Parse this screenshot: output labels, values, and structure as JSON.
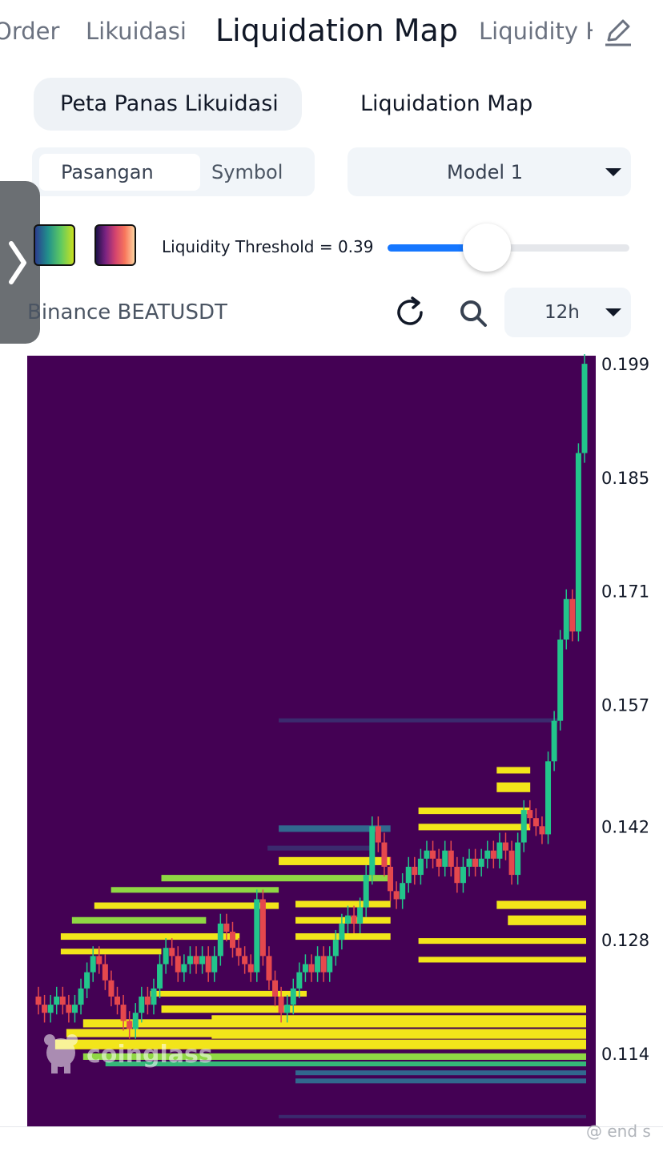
{
  "nav": {
    "order": "Order",
    "likuidasi": "Likuidasi",
    "liquidation_map": "Liquidation Map",
    "liquidity_heatmap": "Liquidity Heatmap"
  },
  "segment": {
    "heatmap": "Peta Panas Likuidasi",
    "map": "Liquidation Map"
  },
  "pair_toggle": {
    "pair": "Pasangan",
    "symbol": "Symbol"
  },
  "model": {
    "selected": "Model 1"
  },
  "threshold": {
    "label": "Liquidity Threshold = 0.39",
    "value": 0.39
  },
  "symbol_title": "Binance BEATUSDT",
  "timeframe": {
    "selected": "12h"
  },
  "icons": {
    "edit": "pencil-icon",
    "refresh": "refresh-icon",
    "search": "search-icon",
    "handle": "chevron-right-icon",
    "logo": "coinglass-logo-icon"
  },
  "watermark": "coinglass",
  "footer_watermark": "@ end s",
  "colors": {
    "heatmap_bg": "#440154",
    "bull": "#22c58b",
    "bear": "#e5484d",
    "accent": "#1677ff"
  },
  "chart_data": {
    "type": "heatmap",
    "y_ticks": [
      "0.199",
      "0.185",
      "0.171",
      "0.157",
      "0.142",
      "0.128",
      "0.114"
    ],
    "ylim": [
      0.105,
      0.2
    ],
    "candles": [
      [
        0.121,
        0.12
      ],
      [
        0.12,
        0.119
      ],
      [
        0.119,
        0.12
      ],
      [
        0.12,
        0.121
      ],
      [
        0.121,
        0.12
      ],
      [
        0.12,
        0.119
      ],
      [
        0.119,
        0.12
      ],
      [
        0.12,
        0.122
      ],
      [
        0.122,
        0.124
      ],
      [
        0.124,
        0.126
      ],
      [
        0.126,
        0.125
      ],
      [
        0.125,
        0.123
      ],
      [
        0.123,
        0.121
      ],
      [
        0.121,
        0.12
      ],
      [
        0.12,
        0.118
      ],
      [
        0.118,
        0.117
      ],
      [
        0.117,
        0.119
      ],
      [
        0.119,
        0.121
      ],
      [
        0.121,
        0.12
      ],
      [
        0.12,
        0.122
      ],
      [
        0.122,
        0.125
      ],
      [
        0.125,
        0.127
      ],
      [
        0.127,
        0.126
      ],
      [
        0.126,
        0.124
      ],
      [
        0.124,
        0.125
      ],
      [
        0.125,
        0.126
      ],
      [
        0.126,
        0.125
      ],
      [
        0.125,
        0.126
      ],
      [
        0.126,
        0.124
      ],
      [
        0.124,
        0.126
      ],
      [
        0.126,
        0.13
      ],
      [
        0.13,
        0.129
      ],
      [
        0.129,
        0.127
      ],
      [
        0.127,
        0.126
      ],
      [
        0.126,
        0.125
      ],
      [
        0.125,
        0.124
      ],
      [
        0.124,
        0.133
      ],
      [
        0.133,
        0.126
      ],
      [
        0.126,
        0.123
      ],
      [
        0.123,
        0.121
      ],
      [
        0.121,
        0.119
      ],
      [
        0.119,
        0.12
      ],
      [
        0.12,
        0.122
      ],
      [
        0.122,
        0.124
      ],
      [
        0.124,
        0.125
      ],
      [
        0.125,
        0.124
      ],
      [
        0.124,
        0.126
      ],
      [
        0.126,
        0.124
      ],
      [
        0.124,
        0.126
      ],
      [
        0.126,
        0.128
      ],
      [
        0.128,
        0.13
      ],
      [
        0.13,
        0.131
      ],
      [
        0.131,
        0.13
      ],
      [
        0.13,
        0.132
      ],
      [
        0.132,
        0.136
      ],
      [
        0.136,
        0.142
      ],
      [
        0.142,
        0.14
      ],
      [
        0.14,
        0.137
      ],
      [
        0.137,
        0.134
      ],
      [
        0.134,
        0.133
      ],
      [
        0.133,
        0.135
      ],
      [
        0.135,
        0.137
      ],
      [
        0.137,
        0.136
      ],
      [
        0.136,
        0.138
      ],
      [
        0.138,
        0.139
      ],
      [
        0.139,
        0.138
      ],
      [
        0.138,
        0.137
      ],
      [
        0.137,
        0.139
      ],
      [
        0.139,
        0.137
      ],
      [
        0.137,
        0.135
      ],
      [
        0.135,
        0.137
      ],
      [
        0.137,
        0.138
      ],
      [
        0.138,
        0.137
      ],
      [
        0.137,
        0.138
      ],
      [
        0.138,
        0.139
      ],
      [
        0.139,
        0.138
      ],
      [
        0.138,
        0.14
      ],
      [
        0.14,
        0.139
      ],
      [
        0.139,
        0.136
      ],
      [
        0.136,
        0.14
      ],
      [
        0.14,
        0.144
      ],
      [
        0.144,
        0.143
      ],
      [
        0.143,
        0.142
      ],
      [
        0.142,
        0.141
      ],
      [
        0.141,
        0.15
      ],
      [
        0.15,
        0.155
      ],
      [
        0.155,
        0.165
      ],
      [
        0.165,
        0.17
      ],
      [
        0.17,
        0.166
      ],
      [
        0.166,
        0.188
      ],
      [
        0.188,
        0.199
      ]
    ],
    "liquidity_bands": [
      {
        "x0": 0.05,
        "x1": 1.0,
        "y": 0.1145,
        "h": 0.0012,
        "c": "#f2e51a"
      },
      {
        "x0": 0.07,
        "x1": 1.0,
        "y": 0.116,
        "h": 0.001,
        "c": "#f2e51a"
      },
      {
        "x0": 0.1,
        "x1": 1.0,
        "y": 0.1172,
        "h": 0.001,
        "c": "#f2e51a"
      },
      {
        "x0": 0.24,
        "x1": 1.0,
        "y": 0.119,
        "h": 0.0009,
        "c": "#f2e51a"
      },
      {
        "x0": 0.33,
        "x1": 1.0,
        "y": 0.1175,
        "h": 0.0012,
        "c": "#f2e51a"
      },
      {
        "x0": 0.33,
        "x1": 1.0,
        "y": 0.1158,
        "h": 0.0012,
        "c": "#f2e51a"
      },
      {
        "x0": 0.1,
        "x1": 1.0,
        "y": 0.1132,
        "h": 0.0008,
        "c": "#8fd744"
      },
      {
        "x0": 0.14,
        "x1": 1.0,
        "y": 0.1124,
        "h": 0.0006,
        "c": "#35b779"
      },
      {
        "x0": 0.48,
        "x1": 1.0,
        "y": 0.1113,
        "h": 0.0006,
        "c": "#31688e"
      },
      {
        "x0": 0.48,
        "x1": 1.0,
        "y": 0.1103,
        "h": 0.0006,
        "c": "#31688e"
      },
      {
        "x0": 0.45,
        "x1": 1.0,
        "y": 0.106,
        "h": 0.0004,
        "c": "#3b2a6e"
      },
      {
        "x0": 0.22,
        "x1": 0.5,
        "y": 0.121,
        "h": 0.0007,
        "c": "#f2e51a"
      },
      {
        "x0": 0.06,
        "x1": 0.24,
        "y": 0.1262,
        "h": 0.0007,
        "c": "#f2e51a"
      },
      {
        "x0": 0.06,
        "x1": 0.38,
        "y": 0.128,
        "h": 0.0008,
        "c": "#f2e51a"
      },
      {
        "x0": 0.08,
        "x1": 0.32,
        "y": 0.13,
        "h": 0.0008,
        "c": "#8fd744"
      },
      {
        "x0": 0.12,
        "x1": 0.45,
        "y": 0.1318,
        "h": 0.0008,
        "c": "#f2e51a"
      },
      {
        "x0": 0.15,
        "x1": 0.45,
        "y": 0.1338,
        "h": 0.0007,
        "c": "#8fd744"
      },
      {
        "x0": 0.24,
        "x1": 0.65,
        "y": 0.1352,
        "h": 0.0008,
        "c": "#8fd744"
      },
      {
        "x0": 0.45,
        "x1": 0.65,
        "y": 0.1372,
        "h": 0.001,
        "c": "#f2e51a"
      },
      {
        "x0": 0.43,
        "x1": 0.62,
        "y": 0.139,
        "h": 0.0006,
        "c": "#3b2a6e"
      },
      {
        "x0": 0.45,
        "x1": 0.65,
        "y": 0.1413,
        "h": 0.0008,
        "c": "#31688e"
      },
      {
        "x0": 0.48,
        "x1": 0.65,
        "y": 0.132,
        "h": 0.0008,
        "c": "#f2e51a"
      },
      {
        "x0": 0.48,
        "x1": 0.65,
        "y": 0.13,
        "h": 0.0008,
        "c": "#f2e51a"
      },
      {
        "x0": 0.48,
        "x1": 0.65,
        "y": 0.128,
        "h": 0.0008,
        "c": "#f2e51a"
      },
      {
        "x0": 0.7,
        "x1": 0.9,
        "y": 0.1435,
        "h": 0.0008,
        "c": "#f2e51a"
      },
      {
        "x0": 0.7,
        "x1": 0.9,
        "y": 0.1415,
        "h": 0.0008,
        "c": "#f2e51a"
      },
      {
        "x0": 0.84,
        "x1": 0.9,
        "y": 0.1485,
        "h": 0.0008,
        "c": "#f2e51a"
      },
      {
        "x0": 0.84,
        "x1": 0.9,
        "y": 0.1462,
        "h": 0.0012,
        "c": "#f2e51a"
      },
      {
        "x0": 0.84,
        "x1": 1.0,
        "y": 0.1318,
        "h": 0.001,
        "c": "#f2e51a"
      },
      {
        "x0": 0.86,
        "x1": 1.0,
        "y": 0.1298,
        "h": 0.0012,
        "c": "#f2e51a"
      },
      {
        "x0": 0.7,
        "x1": 1.0,
        "y": 0.1275,
        "h": 0.0007,
        "c": "#f2e51a"
      },
      {
        "x0": 0.7,
        "x1": 1.0,
        "y": 0.1252,
        "h": 0.0007,
        "c": "#f2e51a"
      },
      {
        "x0": 0.45,
        "x1": 0.95,
        "y": 0.1548,
        "h": 0.0005,
        "c": "#3b2a6e"
      }
    ]
  }
}
